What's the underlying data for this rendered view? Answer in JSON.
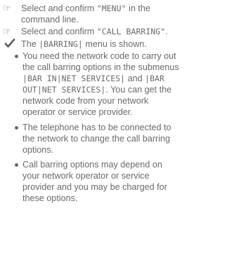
{
  "steps": [
    {
      "icon": "pointing-hand-icon",
      "pre": "Select and confirm ",
      "code": "\"MENU\"",
      "post": " in the",
      "line2": "command line."
    },
    {
      "icon": "pointing-hand-icon",
      "pre": "Select and confirm ",
      "code": "\"CALL BARRING\"",
      "post": "."
    }
  ],
  "result": {
    "icon": "checkmark-icon",
    "pre": "The ",
    "code": "|BARRING|",
    "post": " menu is shown."
  },
  "notes": [
    {
      "l1": "You need the network code to carry out",
      "l2": "the call barring options in the submenus",
      "l3_code": "|BAR IN|NET SERVICES|",
      "l3_text": " and ",
      "l3_code2": "|BAR",
      "l4_code": "OUT|NET SERVICES|",
      "l4_text": ". You can get the",
      "l5": "network code from your network",
      "l6": "operator or service provider."
    },
    {
      "l1": "The telephone has to be connected to",
      "l2": "the network to change the call barring",
      "l3": "options."
    },
    {
      "l1": "Call barring options may depend on",
      "l2": "your network operator or service",
      "l3": "provider and you may be charged for",
      "l4": "these options."
    }
  ]
}
